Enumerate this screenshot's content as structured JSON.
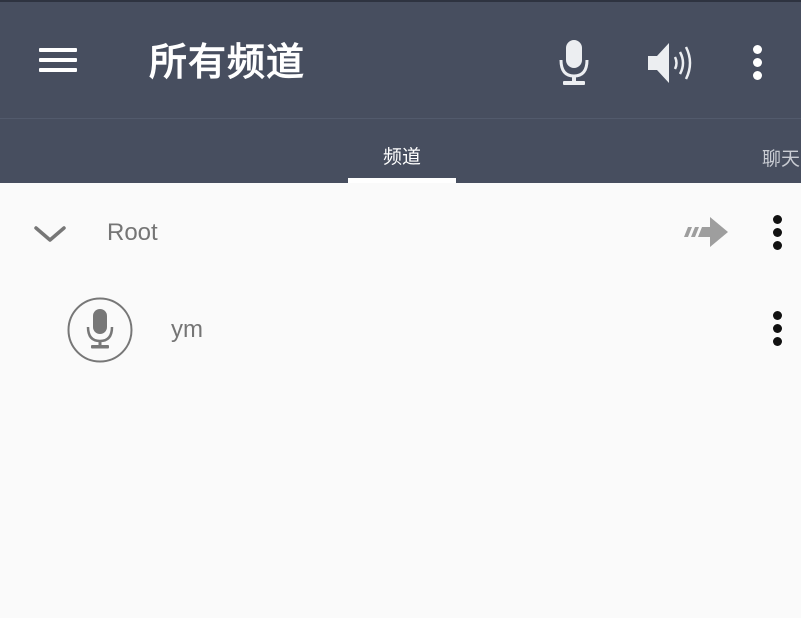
{
  "app_bar": {
    "title": "所有频道",
    "menu_icon": "menu-icon",
    "actions": [
      {
        "icon": "microphone-icon"
      },
      {
        "icon": "speaker-volume-icon"
      },
      {
        "icon": "more-vertical-icon"
      }
    ],
    "background_color": "#474e5f"
  },
  "tabs": [
    {
      "label": "频道",
      "selected": true
    },
    {
      "label": "聊天",
      "selected": false
    }
  ],
  "channel_tree": {
    "root": {
      "name": "Root",
      "expanded": true,
      "expand_icon": "chevron-down-icon",
      "join_icon": "join-arrow-icon",
      "menu_icon": "more-vertical-icon"
    },
    "users": [
      {
        "name": "ym",
        "avatar_icon": "microphone-icon",
        "menu_icon": "more-vertical-icon"
      }
    ]
  },
  "colors": {
    "toolbar": "#474e5f",
    "toolbar_text": "#ffffff",
    "list_background": "#fafafa",
    "secondary_text": "#757575"
  }
}
